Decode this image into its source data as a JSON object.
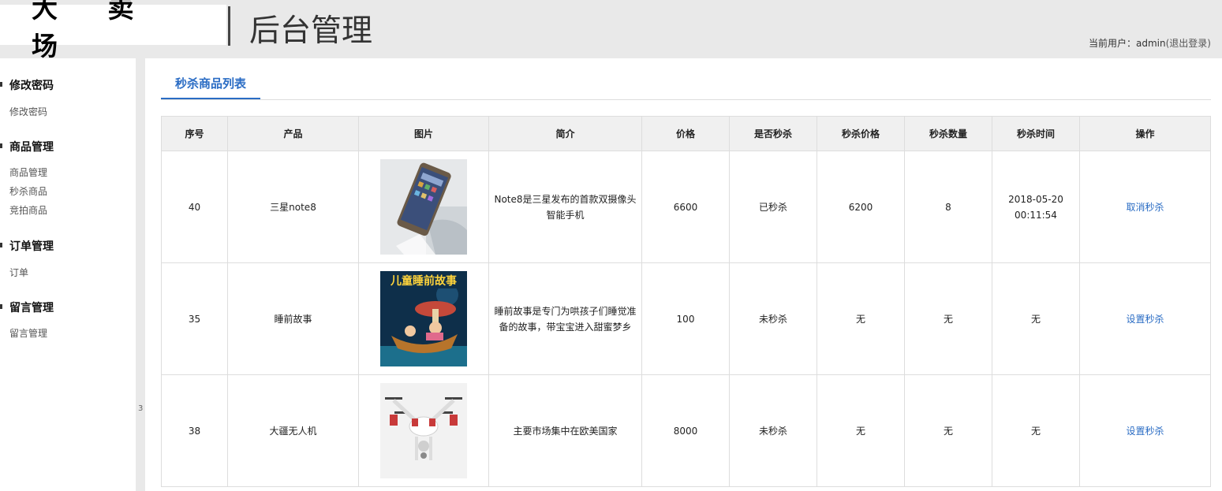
{
  "header": {
    "brand": "大 卖 场",
    "title": "后台管理",
    "user_prefix": "当前用户：",
    "username": "admin",
    "logout": "(退出登录)"
  },
  "sidebar": {
    "groups": [
      {
        "title": "修改密码",
        "items": [
          "修改密码"
        ]
      },
      {
        "title": "商品管理",
        "items": [
          "商品管理",
          "秒杀商品",
          "竞拍商品"
        ]
      },
      {
        "title": "订单管理",
        "items": [
          "订单"
        ]
      },
      {
        "title": "留言管理",
        "items": [
          "留言管理"
        ]
      }
    ],
    "gutter_mark": "3"
  },
  "main": {
    "tab": "秒杀商品列表",
    "columns": [
      "序号",
      "产品",
      "图片",
      "简介",
      "价格",
      "是否秒杀",
      "秒杀价格",
      "秒杀数量",
      "秒杀时间",
      "操作"
    ],
    "rows": [
      {
        "id": "40",
        "product": "三星note8",
        "image": "phone-photo",
        "desc": "Note8是三星发布的首款双摄像头智能手机",
        "price": "6600",
        "seckill": "已秒杀",
        "seckill_price": "6200",
        "seckill_qty": "8",
        "seckill_date": "2018-05-20",
        "seckill_time": "00:11:54",
        "action": "取消秒杀"
      },
      {
        "id": "35",
        "product": "睡前故事",
        "image": "bedtime-story-cover",
        "image_caption": "儿童睡前故事",
        "desc": "睡前故事是专门为哄孩子们睡觉准备的故事，带宝宝进入甜蜜梦乡",
        "price": "100",
        "seckill": "未秒杀",
        "seckill_price": "无",
        "seckill_qty": "无",
        "seckill_date": "无",
        "seckill_time": "",
        "action": "设置秒杀"
      },
      {
        "id": "38",
        "product": "大疆无人机",
        "image": "drone-photo",
        "desc": "主要市场集中在欧美国家",
        "price": "8000",
        "seckill": "未秒杀",
        "seckill_price": "无",
        "seckill_qty": "无",
        "seckill_date": "无",
        "seckill_time": "",
        "action": "设置秒杀"
      }
    ]
  }
}
